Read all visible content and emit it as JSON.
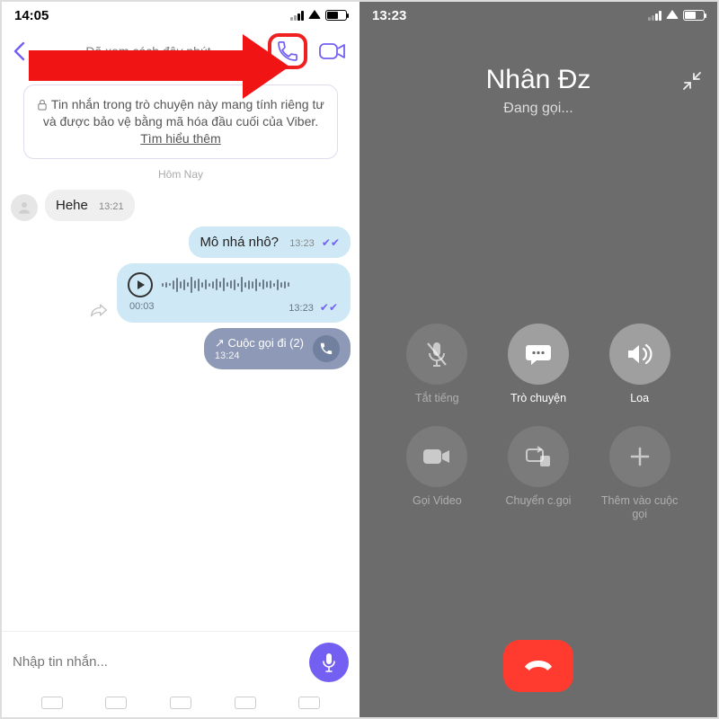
{
  "left": {
    "status_time": "14:05",
    "header_subtitle": "Đã xem cách đây       phút",
    "encryption_notice": "Tin nhắn trong trò chuyện này mang tính riêng tư và được bảo vệ bằng mã hóa đầu cuối của Viber. ",
    "encryption_link": "Tìm hiểu thêm",
    "date_divider": "Hôm Nay",
    "incoming": {
      "text": "Hehe",
      "time": "13:21"
    },
    "outgoing_text": {
      "text": "Mô nhá nhô?",
      "time": "13:23"
    },
    "voice": {
      "duration": "00:03",
      "time": "13:23"
    },
    "call_event": {
      "label": "Cuộc gọi đi (2)",
      "time": "13:24"
    },
    "composer_placeholder": "Nhập tin nhắn..."
  },
  "right": {
    "status_time": "13:23",
    "name": "Nhân Đz",
    "status": "Đang gọi...",
    "buttons": {
      "mute": "Tắt tiếng",
      "chat": "Trò chuyện",
      "speaker": "Loa",
      "video": "Gọi Video",
      "transfer": "Chuyển c.gọi",
      "add": "Thêm vào cuộc gọi"
    }
  },
  "colors": {
    "accent": "#7360f2",
    "highlight": "#f02020",
    "hangup": "#ff3b30"
  }
}
